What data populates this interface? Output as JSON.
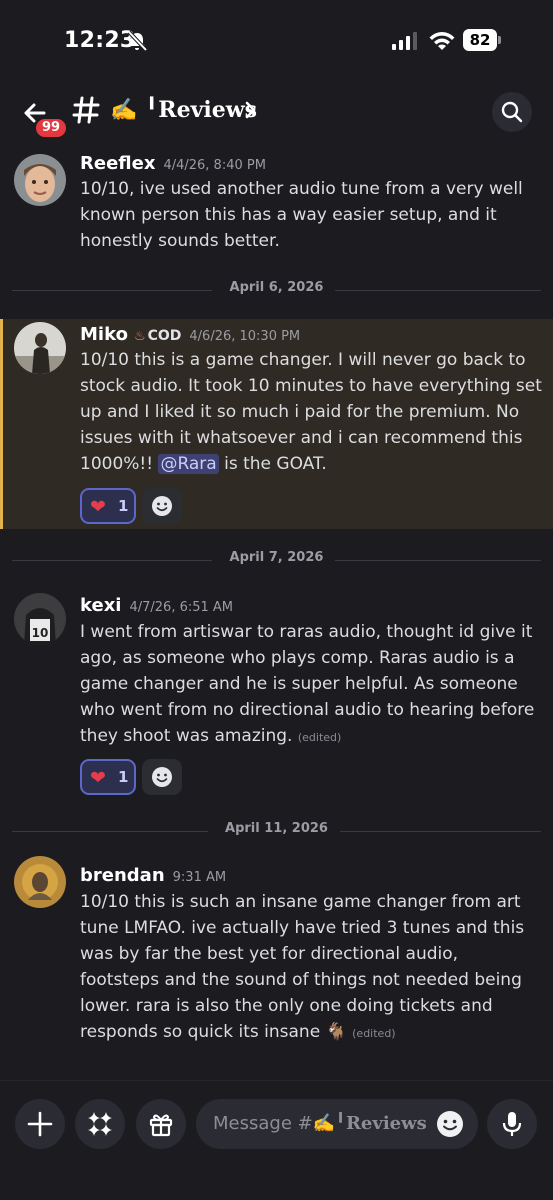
{
  "status": {
    "time": "12:23",
    "battery": "82"
  },
  "header": {
    "badge": "99",
    "channel": "✍️ ╹Reviews"
  },
  "messages": [
    {
      "author": "Reeflex",
      "timestamp": "4/4/26, 8:40 PM",
      "text": "10/10, ive used another audio tune from a very well known person this has a way easier setup, and it honestly sounds better."
    },
    {
      "author": "Miko",
      "tag": "COD",
      "timestamp": "4/6/26, 10:30 PM",
      "text_before": "10/10 this is a game changer.  I will never go back to stock audio.  It took 10 minutes to have everything set up and I liked it so much i paid for the premium.  No issues with it whatsoever and i can recommend this 1000%!! ",
      "mention": "@Rara",
      "text_after": " is the GOAT.",
      "reaction": {
        "emoji": "❤️",
        "count": "1"
      }
    },
    {
      "author": "kexi",
      "timestamp": "4/7/26, 6:51 AM",
      "text": "I went from artiswar to raras audio, thought id give it ago, as someone who plays comp. Raras audio is a game changer and he is super helpful. As someone who went from no directional audio to hearing before they shoot was amazing.",
      "edited": "(edited)",
      "reaction": {
        "emoji": "❤️",
        "count": "1"
      }
    },
    {
      "author": "brendan",
      "timestamp": "9:31 AM",
      "text": "10/10 this is such an insane game changer from art tune LMFAO. ive actually have tried 3 tunes and this was by far the best yet for directional audio, footsteps and the sound of things not needed being lower. rara is also the only one doing tickets and responds so quick its insane 🐐",
      "edited": "(edited)"
    }
  ],
  "dividers": [
    "April 6, 2026",
    "April 7, 2026",
    "April 11, 2026"
  ],
  "composer": {
    "placeholder_prefix": "Message #",
    "placeholder_channel": "✍️╹Reviews"
  },
  "colors": {
    "accent": "#5d66c9",
    "highlight_bg": "#2f2a23",
    "highlight_bar": "#e5b14b",
    "badge": "#e4373f",
    "mention_bg": "#3e4171"
  }
}
